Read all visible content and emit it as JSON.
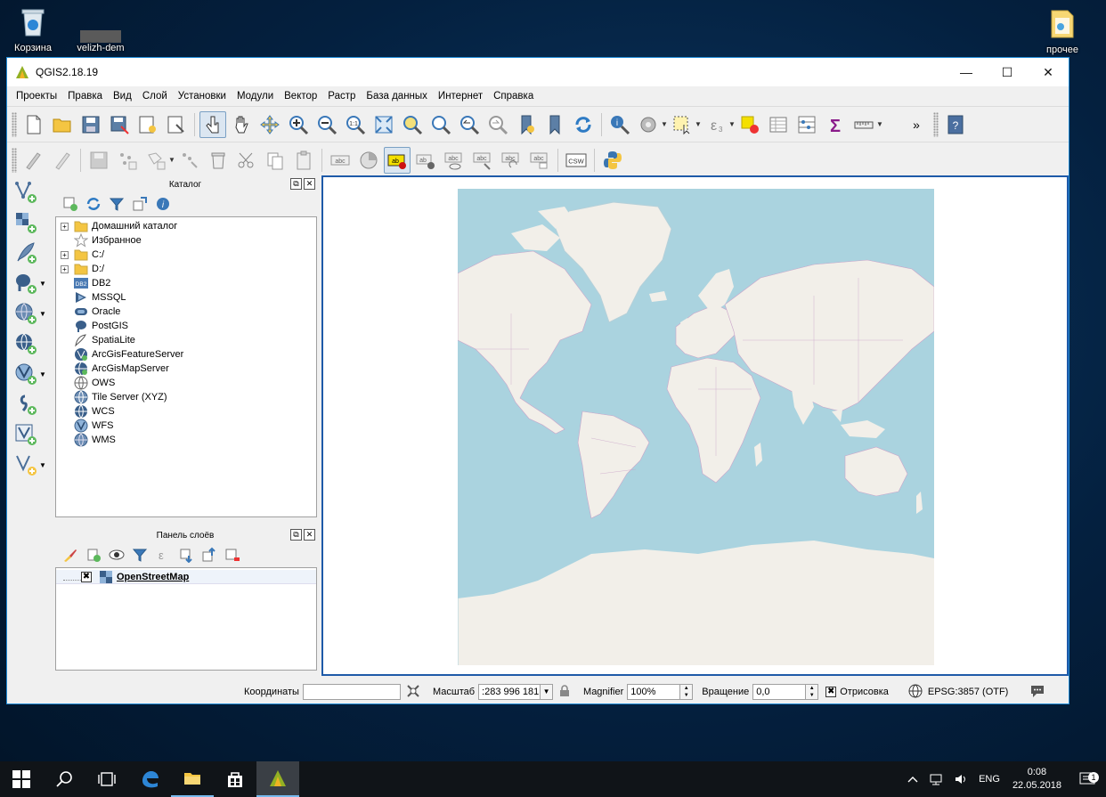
{
  "desktop": {
    "icons": [
      {
        "label": "Корзина"
      },
      {
        "label": "velizh-dem"
      },
      {
        "label": "прочее"
      }
    ]
  },
  "window": {
    "title": "QGIS2.18.19",
    "controls": {
      "minimize": "—",
      "maximize": "☐",
      "close": "✕"
    }
  },
  "menu": {
    "items": [
      "Проекты",
      "Правка",
      "Вид",
      "Слой",
      "Установки",
      "Модули",
      "Вектор",
      "Растр",
      "База данных",
      "Интернет",
      "Справка"
    ]
  },
  "toolbar": {
    "overflow": "»",
    "csw_label": "CSW",
    "abc_label": "abc",
    "ab_label": "ab"
  },
  "catalog": {
    "title": "Каталог",
    "float_btn": "⧉",
    "close_btn": "✕",
    "items": [
      {
        "label": "Домашний каталог",
        "icon": "folder-icon",
        "expandable": true
      },
      {
        "label": "Избранное",
        "icon": "star-icon",
        "expandable": false
      },
      {
        "label": "C:/",
        "icon": "folder-icon",
        "expandable": true
      },
      {
        "label": "D:/",
        "icon": "folder-icon",
        "expandable": true
      },
      {
        "label": "DB2",
        "icon": "db2-icon",
        "expandable": false
      },
      {
        "label": "MSSQL",
        "icon": "mssql-icon",
        "expandable": false
      },
      {
        "label": "Oracle",
        "icon": "oracle-icon",
        "expandable": false
      },
      {
        "label": "PostGIS",
        "icon": "postgis-icon",
        "expandable": false
      },
      {
        "label": "SpatiaLite",
        "icon": "spatialite-icon",
        "expandable": false
      },
      {
        "label": "ArcGisFeatureServer",
        "icon": "arcgis-feature-icon",
        "expandable": false
      },
      {
        "label": "ArcGisMapServer",
        "icon": "arcgis-map-icon",
        "expandable": false
      },
      {
        "label": "OWS",
        "icon": "ows-icon",
        "expandable": false
      },
      {
        "label": "Tile Server (XYZ)",
        "icon": "tile-server-icon",
        "expandable": false
      },
      {
        "label": "WCS",
        "icon": "wcs-icon",
        "expandable": false
      },
      {
        "label": "WFS",
        "icon": "wfs-icon",
        "expandable": false
      },
      {
        "label": "WMS",
        "icon": "wms-icon",
        "expandable": false
      }
    ],
    "db2_badge": "DB2"
  },
  "layers": {
    "title": "Панель слоёв",
    "float_btn": "⧉",
    "close_btn": "✕",
    "items": [
      {
        "label": "OpenStreetMap",
        "checked": true,
        "check_mark": "✖"
      }
    ]
  },
  "statusbar": {
    "coords_label": "Координаты",
    "coords_value": "",
    "scale_label": "Масштаб",
    "scale_value": ":283 996 181",
    "magnifier_label": "Magnifier",
    "magnifier_value": "100%",
    "rotation_label": "Вращение",
    "rotation_value": "0,0",
    "render_label": "Отрисовка",
    "render_mark": "✖",
    "crs_label": "EPSG:3857 (OTF)"
  },
  "taskbar": {
    "lang": "ENG",
    "time": "0:08",
    "date": "22.05.2018",
    "notification_count": "1"
  },
  "colors": {
    "water": "#aad3df",
    "land": "#f2efe9",
    "border": "#c9a3c9",
    "accent": "#1e8ad6"
  }
}
